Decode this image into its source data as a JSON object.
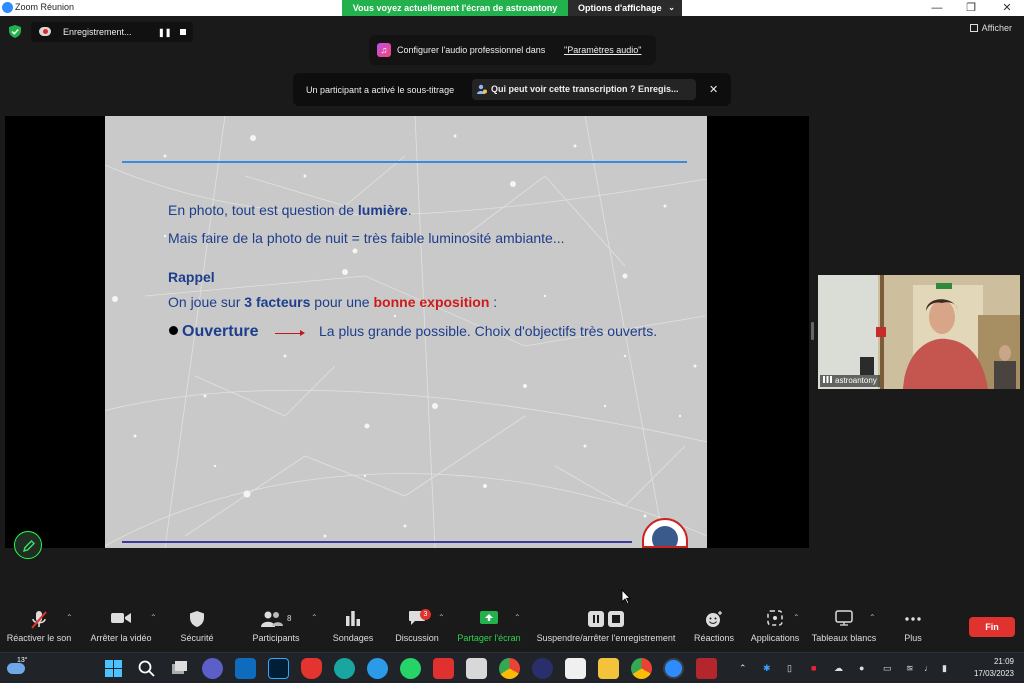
{
  "window": {
    "title": "Zoom Réunion",
    "share_banner": "Vous voyez actuellement l'écran de astroantony",
    "view_options": "Options d'affichage"
  },
  "recording": {
    "label": "Enregistrement..."
  },
  "afficher": "Afficher",
  "audio_banner": {
    "text": "Configurer l'audio professionnel dans",
    "link": "\"Paramètres audio\""
  },
  "caption_banner": {
    "text": "Un participant a activé le sous-titrage",
    "button": "Qui peut voir cette transcription ? Enregis..."
  },
  "slide": {
    "line1_pre": "En photo, tout est question de ",
    "line1_bold": "lumière",
    "line1_post": ".",
    "line2": "Mais faire de la photo de nuit = très faible luminosité ambiante...",
    "rappel": "Rappel",
    "line3_pre": "On joue sur ",
    "line3_bold": "3 facteurs",
    "line3_mid": " pour une ",
    "line3_red": "bonne exposition",
    "line3_post": " :",
    "bullet_term": "Ouverture",
    "bullet_text": "La plus grande possible. Choix d'objectifs très ouverts."
  },
  "video": {
    "name": "astroantony"
  },
  "toolbar": {
    "unmute": "Réactiver le son",
    "stop_video": "Arrêter la vidéo",
    "security": "Sécurité",
    "participants": "Participants",
    "participants_count": "8",
    "polls": "Sondages",
    "chat": "Discussion",
    "chat_badge": "3",
    "share": "Partager l'écran",
    "record": "Suspendre/arrêter l'enregistrement",
    "reactions": "Réactions",
    "apps": "Applications",
    "whiteboards": "Tableaux blancs",
    "more": "Plus",
    "end": "Fin"
  },
  "taskbar": {
    "weather_temp": "13°",
    "time": "21:09",
    "date": "17/03/2023"
  }
}
